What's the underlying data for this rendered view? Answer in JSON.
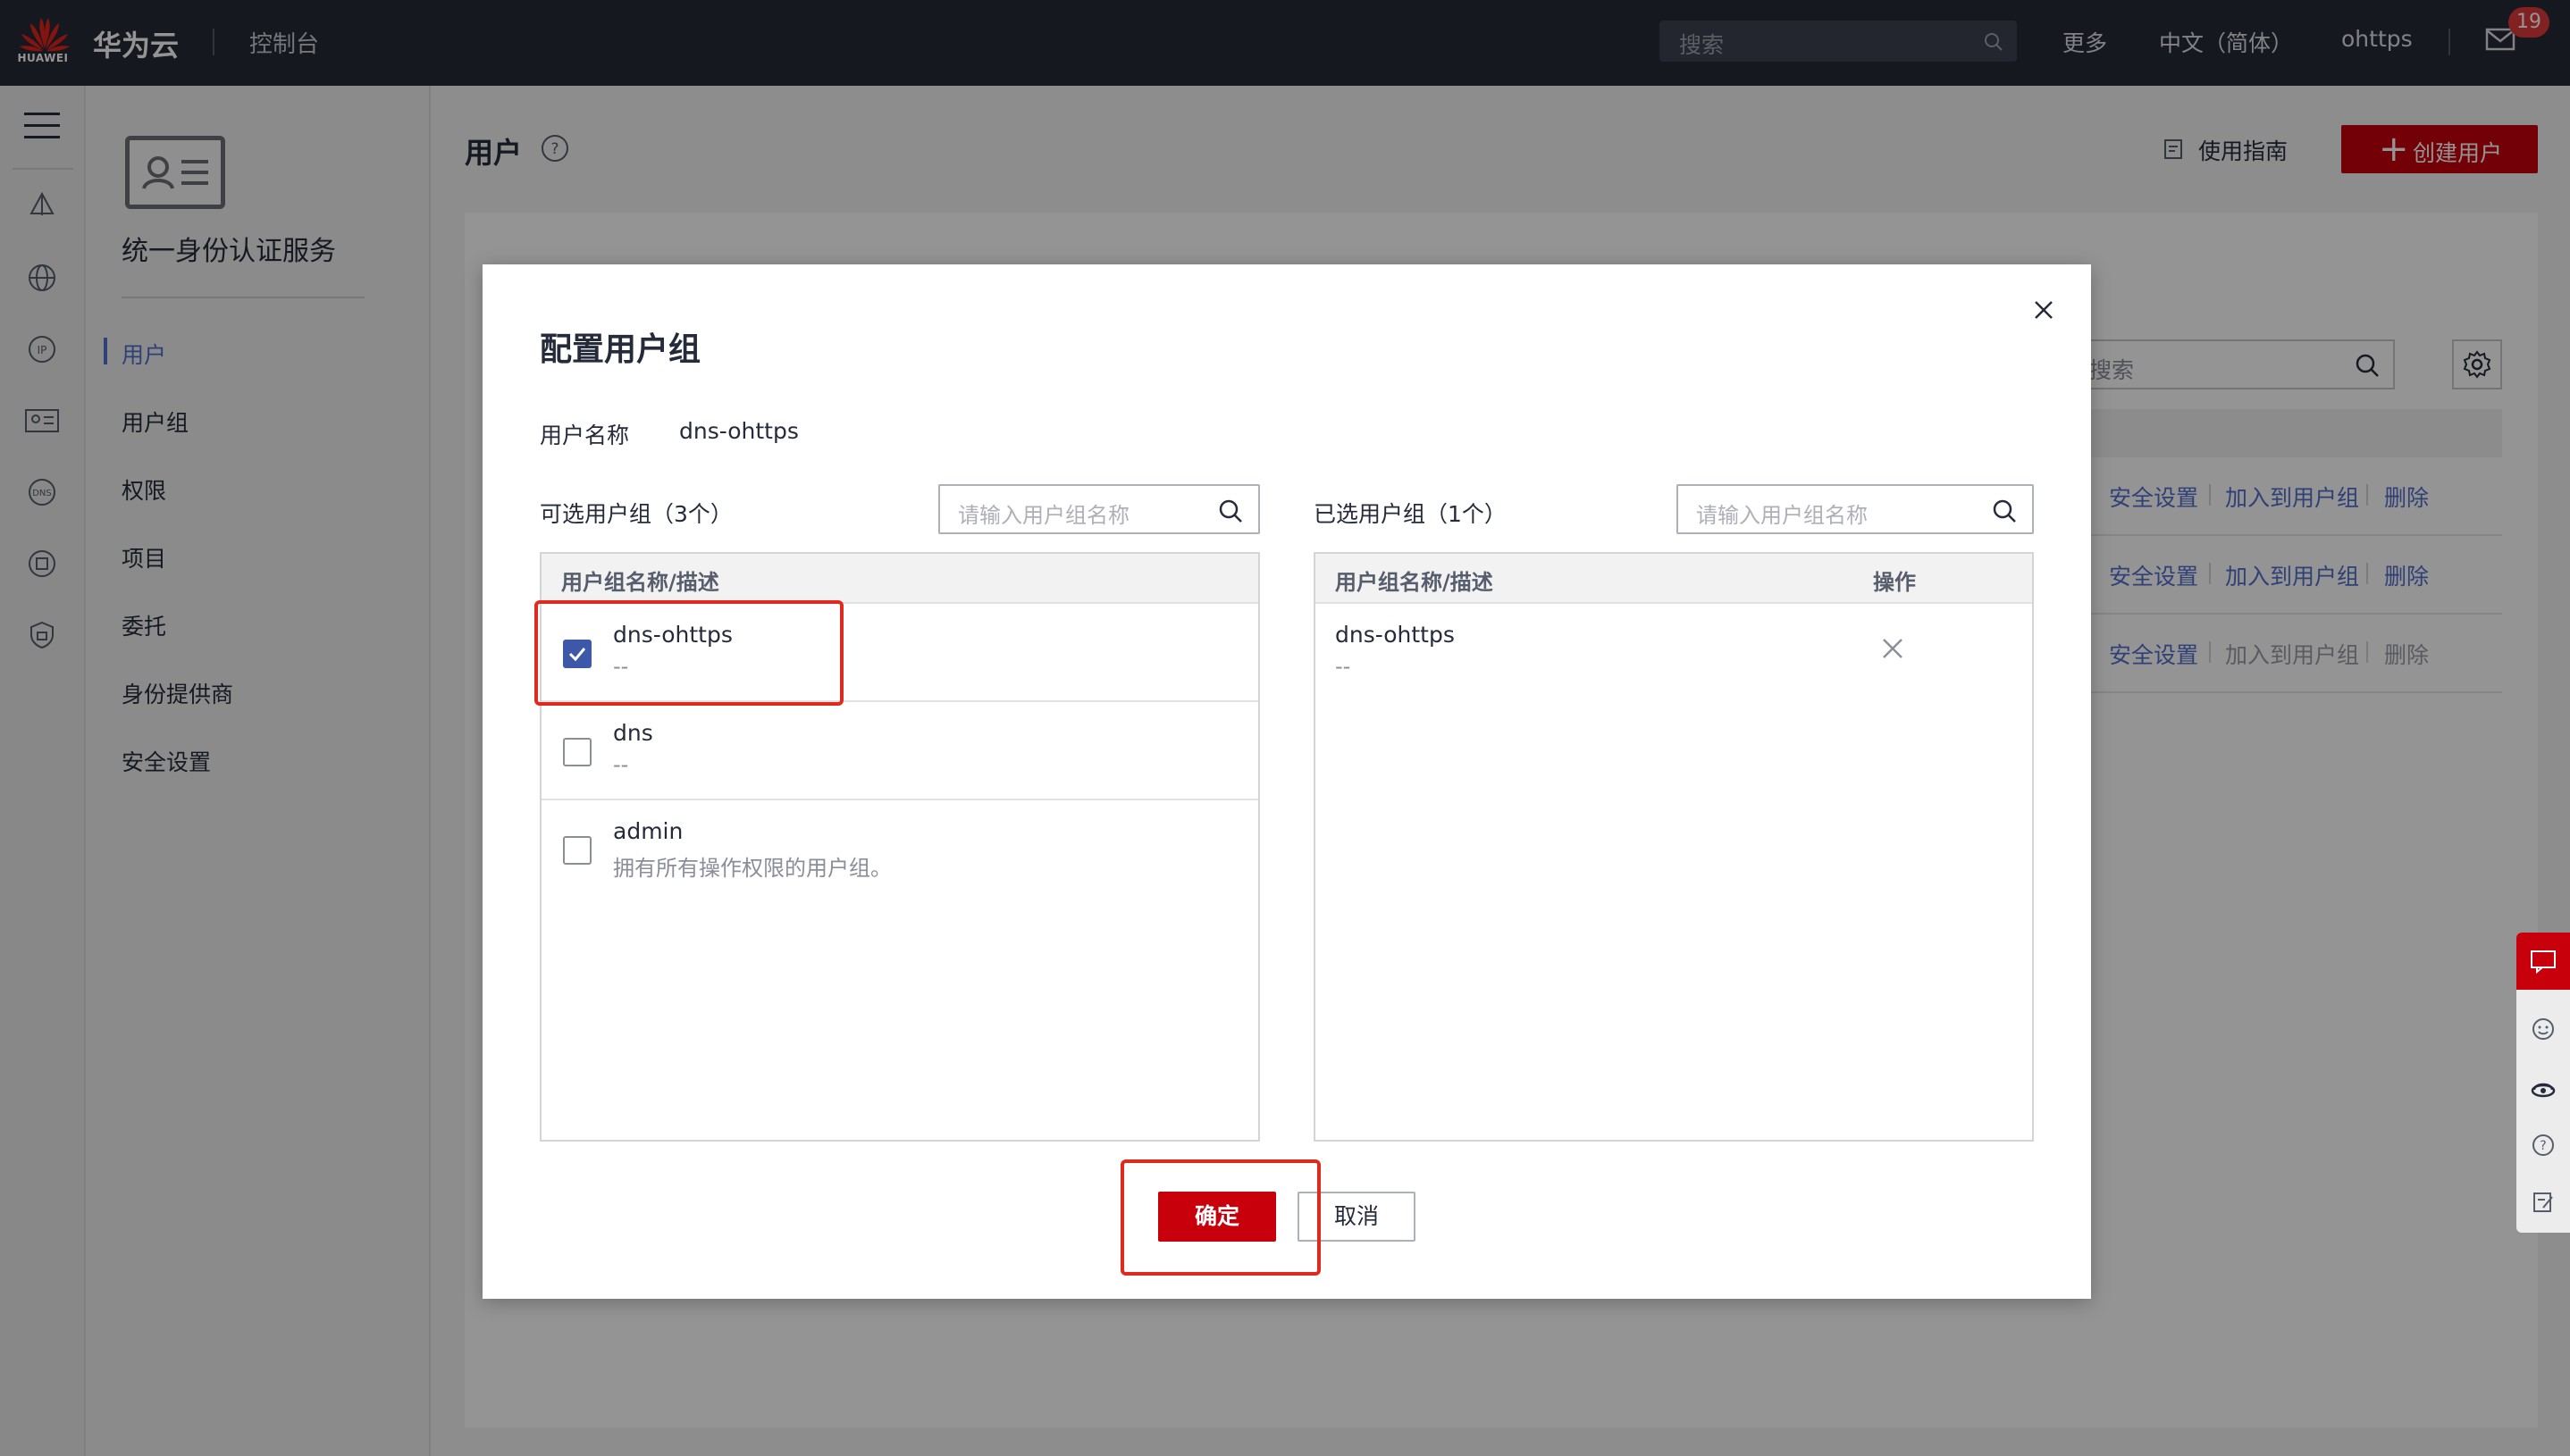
{
  "topbar": {
    "logo_text": "HUAWEI",
    "brand": "华为云",
    "console": "控制台",
    "search_placeholder": "搜索",
    "more": "更多",
    "language": "中文（简体）",
    "username": "ohttps",
    "mail_count": "19"
  },
  "sidebar": {
    "service_title": "统一身份认证服务",
    "items": [
      {
        "label": "用户"
      },
      {
        "label": "用户组"
      },
      {
        "label": "权限"
      },
      {
        "label": "项目"
      },
      {
        "label": "委托"
      },
      {
        "label": "身份提供商"
      },
      {
        "label": "安全设置"
      }
    ]
  },
  "main": {
    "title": "用户",
    "guide_label": "使用指南",
    "create_button": "创建用户",
    "search_placeholder": "搜索",
    "rows": [
      {
        "security": "安全设置",
        "join": "加入到用户组",
        "delete": "删除"
      },
      {
        "security": "安全设置",
        "join": "加入到用户组",
        "delete": "删除"
      },
      {
        "security": "安全设置",
        "join": "加入到用户组",
        "delete": "删除"
      }
    ]
  },
  "dialog": {
    "title": "配置用户组",
    "username_label": "用户名称",
    "username_value": "dns-ohttps",
    "available": {
      "title": "可选用户组（3个）",
      "search_placeholder": "请输入用户组名称",
      "column": "用户组名称/描述",
      "rows": [
        {
          "name": "dns-ohttps",
          "desc": "--",
          "checked": true
        },
        {
          "name": "dns",
          "desc": "--",
          "checked": false
        },
        {
          "name": "admin",
          "desc": "拥有所有操作权限的用户组。",
          "checked": false
        }
      ]
    },
    "selected": {
      "title": "已选用户组（1个）",
      "search_placeholder": "请输入用户组名称",
      "column_name": "用户组名称/描述",
      "column_action": "操作",
      "rows": [
        {
          "name": "dns-ohttps",
          "desc": "--"
        }
      ]
    },
    "ok_button": "确定",
    "cancel_button": "取消"
  },
  "colors": {
    "brand_red": "#c7000b",
    "accent_blue": "#526ecc",
    "highlight_red": "#e02a1f",
    "topbar_bg": "#252a36"
  }
}
